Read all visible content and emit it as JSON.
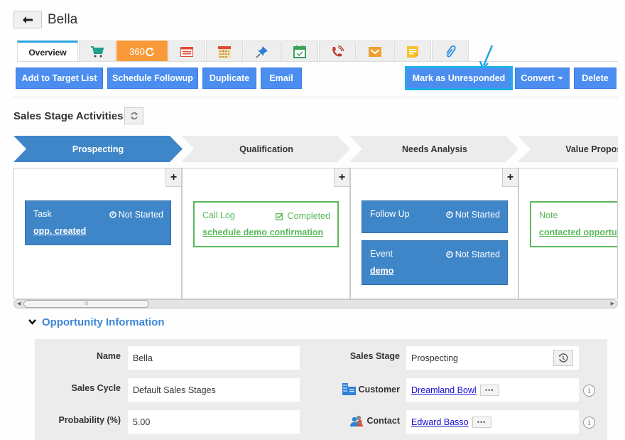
{
  "header": {
    "back_icon": "arrow-left-icon",
    "title": "Bella"
  },
  "tabs": [
    {
      "label": "Overview",
      "active": true
    },
    {
      "icon": "cart-icon"
    },
    {
      "label": "360",
      "icon": "360-refresh-icon",
      "color": "#f89a3a"
    },
    {
      "icon": "newspaper-icon"
    },
    {
      "icon": "calendar-grid-icon"
    },
    {
      "icon": "pushpin-icon"
    },
    {
      "icon": "calendar-check-icon"
    },
    {
      "icon": "phone-call-icon"
    },
    {
      "icon": "envelope-icon"
    },
    {
      "icon": "sticky-note-icon"
    },
    {
      "icon": "paperclip-icon"
    }
  ],
  "actions": {
    "add_to_target_list": "Add to Target List",
    "schedule_followup": "Schedule Followup",
    "duplicate": "Duplicate",
    "email": "Email",
    "mark_unresponded": "Mark as Unresponded",
    "convert": "Convert",
    "delete": "Delete"
  },
  "sales_stage": {
    "title": "Sales Stage Activities",
    "stages": [
      {
        "label": "Prospecting",
        "active": true
      },
      {
        "label": "Qualification",
        "active": false
      },
      {
        "label": "Needs Analysis",
        "active": false
      },
      {
        "label": "Value Proposition",
        "active": false
      }
    ],
    "columns": [
      {
        "cards": [
          {
            "type": "Task",
            "status": "Not Started",
            "subject": "opp. created",
            "style": "blue"
          }
        ]
      },
      {
        "cards": [
          {
            "type": "Call Log",
            "status": "Completed",
            "subject": "schedule demo confirmation",
            "style": "green"
          }
        ]
      },
      {
        "cards": [
          {
            "type": "Follow Up",
            "status": "Not Started",
            "subject": "",
            "style": "blue"
          },
          {
            "type": "Event",
            "status": "Not Started",
            "subject": "demo",
            "style": "blue"
          }
        ]
      },
      {
        "cards": [
          {
            "type": "Note",
            "status": "",
            "subject": "contacted opportunity",
            "style": "green"
          }
        ]
      }
    ]
  },
  "opportunity": {
    "title": "Opportunity Information",
    "fields": {
      "name": {
        "label": "Name",
        "value": "Bella"
      },
      "sales_cycle": {
        "label": "Sales Cycle",
        "value": "Default Sales Stages"
      },
      "probability": {
        "label": "Probability (%)",
        "value": "5.00"
      },
      "sales_stage": {
        "label": "Sales Stage",
        "value": "Prospecting"
      },
      "customer": {
        "label": "Customer",
        "value": "Dreamland Bowl"
      },
      "contact": {
        "label": "Contact",
        "value": "Edward Basso"
      }
    },
    "dots_label": "•••",
    "info_label": "i"
  },
  "colors": {
    "primary_button": "#4c8ef0",
    "stage_active": "#3f86c8",
    "stage_inactive": "#ececec",
    "completed_green": "#5cb85c",
    "section_title_blue": "#3d86d6",
    "tab_360_orange": "#f89a3a"
  }
}
